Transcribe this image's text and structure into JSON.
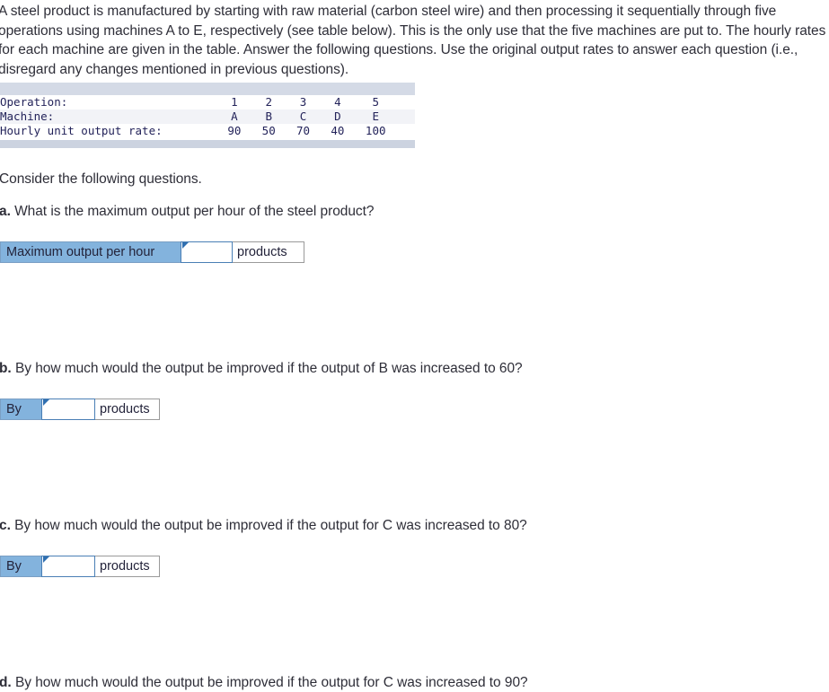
{
  "intro": {
    "paragraph": "A steel product is manufactured by starting with raw material (carbon steel wire) and then processing it sequentially through five operations using machines A to E, respectively (see table below). This is the only use that the five machines are put to. The hourly rates for each machine are given in the table. Answer the following questions. Use the original output rates to answer each question (i.e., disregard any changes mentioned in previous questions)."
  },
  "rates_table": {
    "rows": [
      {
        "label": "Operation:",
        "values": [
          "1",
          "2",
          "3",
          "4",
          "5"
        ]
      },
      {
        "label": "Machine:",
        "values": [
          "A",
          "B",
          "C",
          "D",
          "E"
        ]
      },
      {
        "label": "Hourly unit output rate:",
        "values": [
          "90",
          "50",
          "70",
          "40",
          "100"
        ]
      }
    ]
  },
  "consider_line": "Consider the following questions.",
  "questions": [
    {
      "marker": "a.",
      "text": " What is the maximum output per hour of the steel product?",
      "answer": {
        "label": "Maximum output per hour",
        "value": "",
        "placeholder": "",
        "unit": "products"
      }
    },
    {
      "marker": "b.",
      "text": " By how much would the output be improved if the output of B was increased to 60?",
      "answer": {
        "label": "By",
        "value": "",
        "placeholder": "",
        "unit": "products"
      }
    },
    {
      "marker": "c.",
      "text": " By how much would the output be improved if the output for C was increased to 80?",
      "answer": {
        "label": "By",
        "value": "",
        "placeholder": "",
        "unit": "products"
      }
    },
    {
      "marker": "d.",
      "text": " By how much would the output be improved if the output for C was increased to 90?"
    }
  ],
  "colors": {
    "answer_label_blue": "#83b3dd",
    "table_band": "#d4dae6",
    "table_shade_row": "#f2f3f7",
    "input_border_blue": "#4a7fb5",
    "text": "#2e2e38",
    "table_text": "#23235a"
  }
}
